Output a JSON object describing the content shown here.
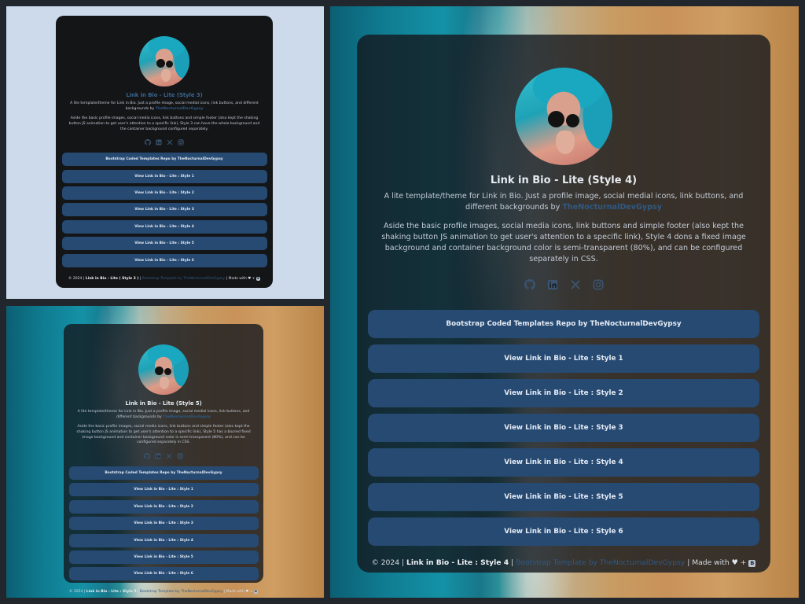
{
  "panels": [
    {
      "title": "Link in Bio - Lite (Style 3)",
      "description_1": "A lite template/theme for Link in Bio. Just a profile image, social medial icons, link buttons, and different backgrounds by",
      "author": "TheNocturnalDevGypsy",
      "description_2": "Aside the basic profile images, social media icons, link buttons and simple footer (also kept the shaking button JS animation to get user's attention to a specific link), Style 3 can have the whole background and the container background configured separately.",
      "buttons": [
        "Bootstrap Coded Templates Repo by TheNocturnalDevGypsy",
        "View Link in Bio - Lite : Style 1",
        "View Link in Bio - Lite : Style 2",
        "View Link in Bio - Lite : Style 3",
        "View Link in Bio - Lite : Style 4",
        "View Link in Bio - Lite : Style 5",
        "View Link in Bio - Lite : Style 6"
      ],
      "footer_prefix": "© 2024 |",
      "footer_name": "Link in Bio - Lite ( Style 3 )",
      "footer_sep": "|",
      "footer_link": "Bootstrap Template by TheNocturnalDevGypsy",
      "footer_made": "| Made with",
      "footer_heart": "♥",
      "footer_plus": "+",
      "footer_bs": "B"
    },
    {
      "title": "Link in Bio - Lite (Style 5)",
      "description_1": "A lite template/theme for Link in Bio. Just a profile image, social medial icons, link buttons, and different backgrounds by",
      "author": "TheNocturnalDevGypsy",
      "description_2": "Aside the basic profile images, social media icons, link buttons and simple footer (also kept the shaking button JS animation to get user's attention to a specific link), Style 5 has a blurred fixed image background and container background color is semi-transparent (80%), and can be configured separately in CSS.",
      "buttons": [
        "Bootstrap Coded Templates Repo by TheNocturnalDevGypsy",
        "View Link in Bio - Lite : Style 1",
        "View Link in Bio - Lite : Style 2",
        "View Link in Bio - Lite : Style 3",
        "View Link in Bio - Lite : Style 4",
        "View Link in Bio - Lite : Style 5",
        "View Link in Bio - Lite : Style 6"
      ],
      "footer_prefix": "© 2024 |",
      "footer_name": "Link in Bio - Lite : Style 5",
      "footer_sep": "|",
      "footer_link": "Bootstrap Template by TheNocturnalDevGypsy",
      "footer_made": "| Made with",
      "footer_heart": "♥",
      "footer_plus": "+",
      "footer_bs": "B"
    },
    {
      "title": "Link in Bio - Lite (Style 4)",
      "description_1": "A lite template/theme for Link in Bio. Just a profile image, social medial icons, link buttons, and different backgrounds by",
      "author": "TheNocturnalDevGypsy",
      "description_2": "Aside the basic profile images, social media icons, link buttons and simple footer (also kept the shaking button JS animation to get user's attention to a specific link), Style 4 dons a fixed image background and container background color is semi-transparent (80%), and can be configured separately in CSS.",
      "buttons": [
        "Bootstrap Coded Templates Repo by TheNocturnalDevGypsy",
        "View Link in Bio - Lite : Style 1",
        "View Link in Bio - Lite : Style 2",
        "View Link in Bio - Lite : Style 3",
        "View Link in Bio - Lite : Style 4",
        "View Link in Bio - Lite : Style 5",
        "View Link in Bio - Lite : Style 6"
      ],
      "footer_prefix": "© 2024 |",
      "footer_name": "Link in Bio - Lite : Style 4",
      "footer_sep": "|",
      "footer_link": "Bootstrap Template by TheNocturnalDevGypsy",
      "footer_made": "| Made with",
      "footer_heart": "♥",
      "footer_plus": "+",
      "footer_bs": "B"
    }
  ],
  "social_icons": [
    "github-icon",
    "linkedin-icon",
    "x-icon",
    "instagram-icon"
  ],
  "colors": {
    "accent": "#2f5a85",
    "button": "#274a73",
    "card_dark": "#141517",
    "page_light": "#ccdaec"
  }
}
